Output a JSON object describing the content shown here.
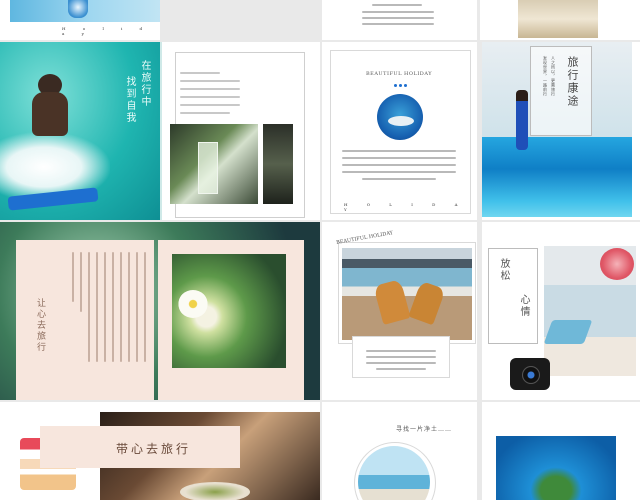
{
  "slides": {
    "r1c1": {
      "caption": "H o l i d a y"
    },
    "r2c1": {
      "title_line1": "在旅行中",
      "title_line2": "找到自我"
    },
    "r2c2": {
      "holiday_label": "H O L I D A Y",
      "heading": "BEAUTIFUL HOLIDAY",
      "bottom_label": "H O L I D A Y"
    },
    "r2c3": {
      "title": "旅行康途",
      "sub1": "人之所以，更需旅行",
      "sub2": "发现世界，一路前行"
    },
    "r3c1": {
      "title": "让心去旅行"
    },
    "r3c2": {
      "heading": "BEAUTIFUL HOLIDAY"
    },
    "r3c3": {
      "title_a": "放松",
      "title_b": "心情"
    },
    "r4c1": {
      "title": "带心去旅行"
    },
    "r4c2": {
      "heading": "寻找一片净土……"
    }
  },
  "colors": {
    "page_bg": "#e9e9e9",
    "teal": "#4ecdc4",
    "sea_blue": "#1e8fd6",
    "peach": "#f7e6dd"
  }
}
